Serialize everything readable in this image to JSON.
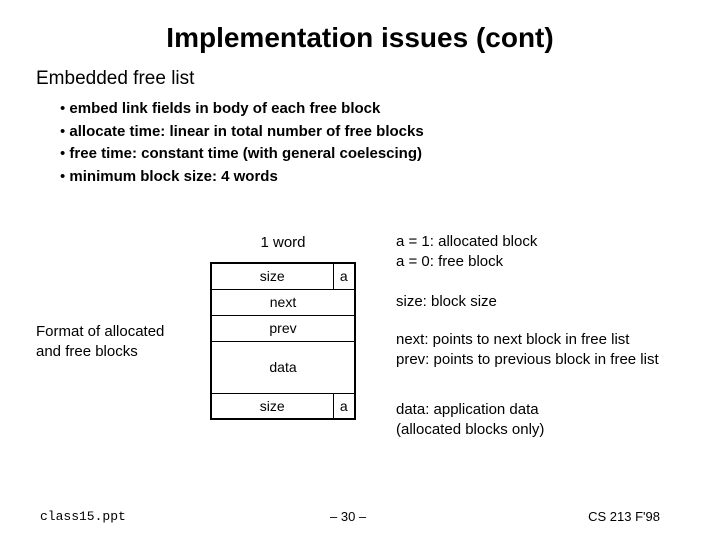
{
  "title": "Implementation issues (cont)",
  "subtitle": "Embedded free list",
  "bullets": [
    "embed link fields in body of each free block",
    "allocate time: linear in total number of free blocks",
    "free time: constant time (with general coelescing)",
    "minimum block size: 4 words"
  ],
  "diagram": {
    "one_word": "1 word",
    "left_caption": "Format of allocated and free blocks",
    "header_size": "size",
    "header_a": "a",
    "next": "next",
    "prev": "prev",
    "data": "data",
    "footer_size": "size",
    "footer_a": "a"
  },
  "legend": {
    "a1": "a = 1: allocated block",
    "a0": "a = 0: free block",
    "size": "size: block size",
    "next": "next: points to next block in free list",
    "prev": "prev: points to previous block in free list",
    "data1": "data: application data",
    "data2": "(allocated blocks only)"
  },
  "footer": {
    "filename": "class15.ppt",
    "page": "– 30 –",
    "course": "CS 213 F'98"
  }
}
